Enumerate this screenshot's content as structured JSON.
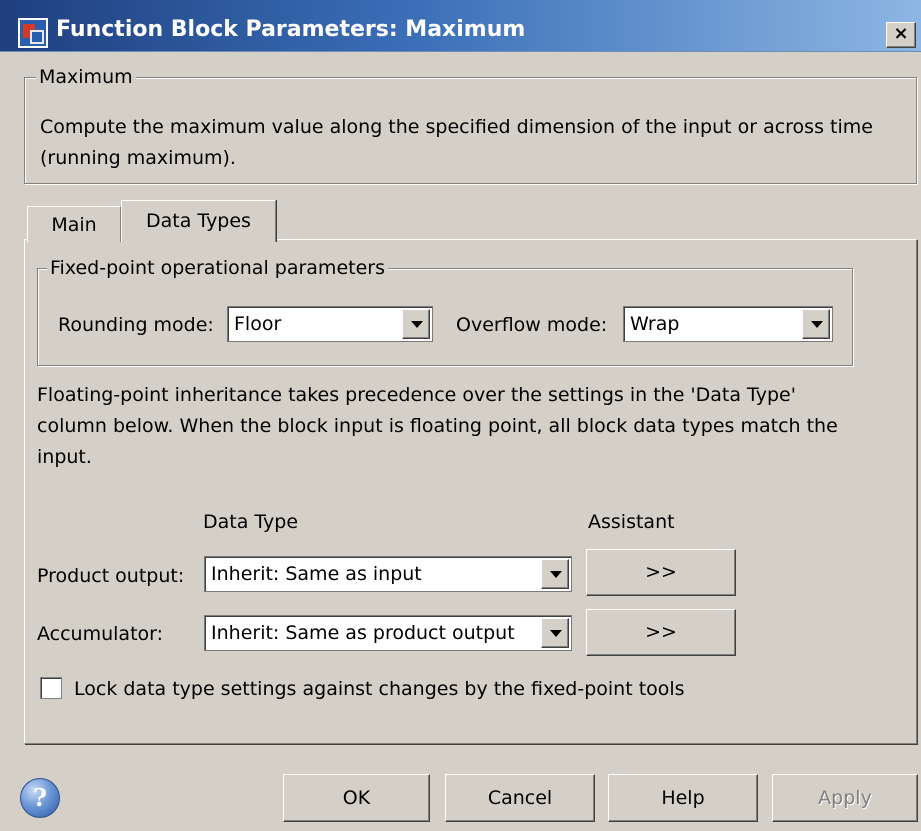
{
  "window": {
    "title": "Function Block Parameters: Maximum",
    "close_glyph": "×"
  },
  "description_group": {
    "legend": "Maximum",
    "text": "Compute the maximum value along the specified dimension of the input or across time (running maximum)."
  },
  "tabs": [
    {
      "label": "Main",
      "active": false
    },
    {
      "label": "Data Types",
      "active": true
    }
  ],
  "fixed_point_group": {
    "legend": "Fixed-point operational parameters",
    "rounding_label": "Rounding mode:",
    "rounding_value": "Floor",
    "overflow_label": "Overflow mode:",
    "overflow_value": "Wrap"
  },
  "inheritance_note": "Floating-point inheritance takes precedence over the settings in the 'Data Type' column below. When the block input is floating point, all block data types match the input.",
  "data_types_table": {
    "col_data_type": "Data Type",
    "col_assistant": "Assistant",
    "rows": [
      {
        "label": "Product output:",
        "value": "Inherit: Same as input",
        "assistant": ">>"
      },
      {
        "label": "Accumulator:",
        "value": "Inherit: Same as product output",
        "assistant": ">>"
      }
    ]
  },
  "lock_checkbox": {
    "label": "Lock data type settings against changes by the fixed-point tools",
    "checked": false
  },
  "footer": {
    "help_icon_glyph": "?",
    "ok": "OK",
    "cancel": "Cancel",
    "help": "Help",
    "apply": "Apply"
  },
  "colors": {
    "dialog_bg": "#d4d0c8",
    "titlebar_start": "#1f3f7f",
    "titlebar_end": "#8db6e3"
  }
}
